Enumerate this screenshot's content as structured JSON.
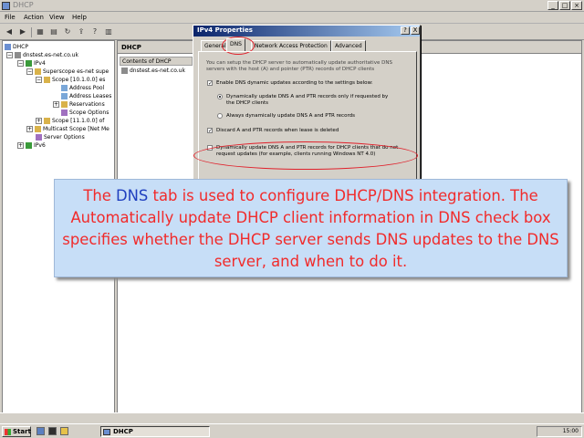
{
  "window": {
    "title": "DHCP"
  },
  "menu": [
    "File",
    "Action",
    "View",
    "Help"
  ],
  "tree": {
    "items": [
      {
        "label": "DHCP"
      },
      {
        "label": "dnstest.es-net.co.uk"
      },
      {
        "label": "IPv4"
      },
      {
        "label": "Superscope es-net supe"
      },
      {
        "label": "Scope [10.1.0.0] es"
      },
      {
        "label": "Address Pool"
      },
      {
        "label": "Address Leases"
      },
      {
        "label": "Reservations"
      },
      {
        "label": "Scope Options"
      },
      {
        "label": "Scope [11.1.0.0] of"
      },
      {
        "label": "Multicast Scope [Net Me"
      },
      {
        "label": "Server Options"
      },
      {
        "label": "IPv6"
      }
    ]
  },
  "right_pane": {
    "header": "DHCP",
    "column": "Contents of DHCP",
    "item": "dnstest.es-net.co.uk"
  },
  "dialog": {
    "title": "IPv4 Properties",
    "help_btn": "?",
    "close_btn": "X",
    "tabs": [
      "General",
      "DNS",
      "Network Access Protection",
      "Advanced"
    ],
    "intro": "You can setup the DHCP server to automatically update authoritative DNS servers with the host (A) and pointer (PTR) records of DHCP clients",
    "enable_label": "Enable DNS dynamic updates according to the settings below:",
    "radio1": "Dynamically update DNS A and PTR records only if requested by the DHCP clients",
    "radio2": "Always dynamically update DNS A and PTR records",
    "discard_label": "Discard A and PTR records when lease is deleted",
    "nonrequest_label": "Dynamically update DNS A and PTR records for DHCP clients that do not request updates (for example, clients running Windows NT 4.0)"
  },
  "caption": {
    "pre": "The ",
    "highlight": "DNS",
    "post": " tab is used to configure DHCP/DNS integration. The Automatically update DHCP client information in DNS check box specifies whether the DHCP server sends DNS updates to the DNS server, and when to do it."
  },
  "taskbar": {
    "start": "Start",
    "task": "DHCP",
    "clock": "15:00"
  },
  "colors": {
    "caption_bg": "#c7def7",
    "caption_text": "#f12b2b",
    "caption_highlight": "#1f3fbf",
    "annotation_ring": "#e0212b"
  }
}
